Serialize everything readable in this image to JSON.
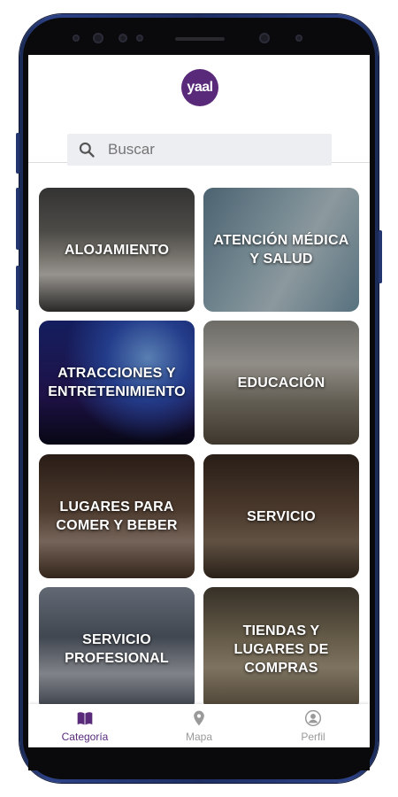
{
  "brand": {
    "logo_text": "yaal",
    "accent": "#5a2a7a"
  },
  "search": {
    "placeholder": "Buscar",
    "icon": "search-icon"
  },
  "categories": [
    {
      "label": "ALOJAMIENTO"
    },
    {
      "label": "ATENCIÓN MÉDICA Y SALUD"
    },
    {
      "label": "ATRACCIONES Y ENTRETENIMIENTO"
    },
    {
      "label": "EDUCACIÓN"
    },
    {
      "label": "LUGARES PARA COMER Y BEBER"
    },
    {
      "label": "SERVICIO"
    },
    {
      "label": "SERVICIO PROFESIONAL"
    },
    {
      "label": "TIENDAS Y LUGARES DE COMPRAS"
    }
  ],
  "bottom_nav": [
    {
      "label": "Categoría",
      "icon": "book-icon",
      "active": true
    },
    {
      "label": "Mapa",
      "icon": "map-pin-icon",
      "active": false
    },
    {
      "label": "Perfil",
      "icon": "user-icon",
      "active": false
    }
  ]
}
